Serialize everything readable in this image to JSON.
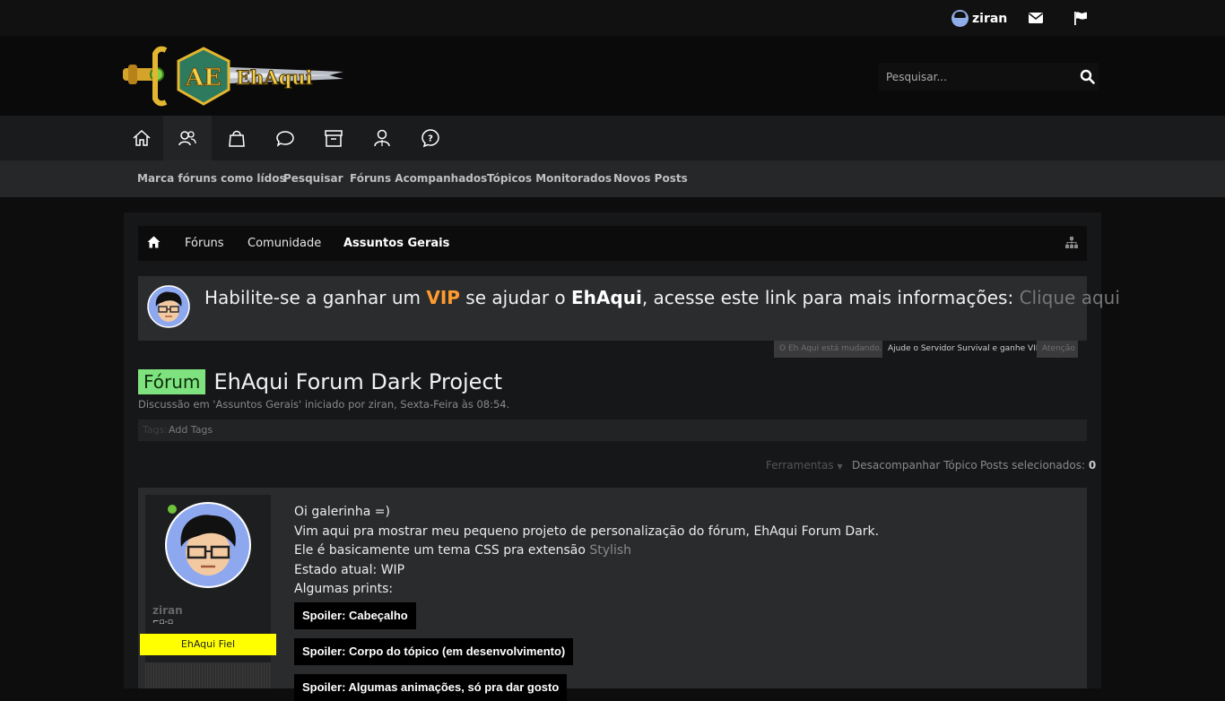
{
  "topbar": {
    "username": "ziran"
  },
  "search": {
    "placeholder": "Pesquisar..."
  },
  "subnav": [
    "Marca fóruns como lídos",
    "Pesquisar",
    "Fóruns Acompanhados",
    "Tópicos Monitorados",
    "Novos Posts"
  ],
  "breadcrumb": [
    "Fóruns",
    "Comunidade",
    "Assuntos Gerais"
  ],
  "notice": {
    "text_1": "Habilite-se a ganhar um ",
    "vip": "VIP",
    "text_2": " se ajudar o ",
    "brand": "EhAqui",
    "text_3": ", acesse este link para mais informações: ",
    "link": "Clique aqui"
  },
  "notice_tabs": [
    "O Eh Aqui está mudando...",
    "Ajude o Servidor Survival e ganhe VIP!",
    "Atenção"
  ],
  "thread": {
    "prefix": "Fórum",
    "title": "EhAqui Forum Dark Project",
    "meta": "Discussão em 'Assuntos Gerais' iniciado por ziran, Sexta-Feira às 08:54."
  },
  "tags": {
    "label": "Tags:",
    "add": "Add Tags"
  },
  "tools": {
    "ferramentas": "Ferramentas",
    "unwatch": "Desacompanhar Tópico",
    "selected_label": "Posts selecionados:",
    "selected_count": "0"
  },
  "post": {
    "author": "ziran",
    "user_title": "⌐▫-▫",
    "badge": "EhAqui Fiel",
    "line1": "Oi galerinha =)",
    "line2": "Vim aqui pra mostrar meu pequeno projeto de personalização do fórum, EhAqui Forum Dark.",
    "line3_text": "Ele é basicamente um tema CSS pra extensão ",
    "line3_link": "Stylish",
    "line4": "Estado atual: WIP",
    "line5": "Algumas prints:",
    "spoilers": [
      "Spoiler: Cabeçalho",
      "Spoiler: Corpo do tópico (em desenvolvimento)",
      "Spoiler: Algumas animações, só pra dar gosto"
    ]
  }
}
